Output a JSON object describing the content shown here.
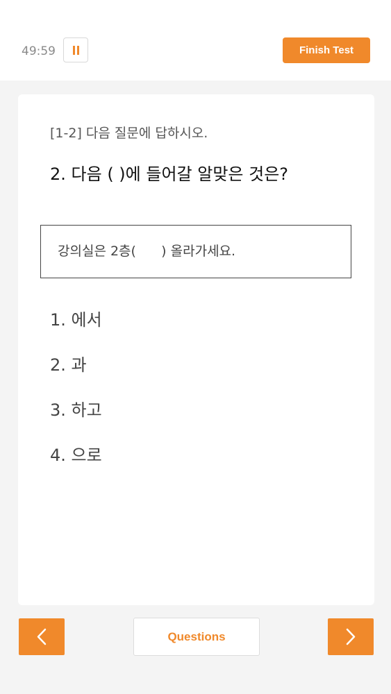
{
  "header": {
    "timer": "49:59",
    "pause_icon": "pause-icon",
    "finish_label": "Finish Test"
  },
  "question": {
    "instruction": "[1-2]  다음 질문에 답하시오.",
    "text": "2. 다음 (          )에 들어갈 알맞은 것은?",
    "passage": "강의실은 2층(      ) 올라가세요.",
    "options": [
      {
        "label": "1. 에서"
      },
      {
        "label": "2. 과"
      },
      {
        "label": "3. 하고"
      },
      {
        "label": "4. 으로"
      }
    ]
  },
  "footer": {
    "prev_icon": "chevron-left-icon",
    "questions_label": "Questions",
    "next_icon": "chevron-right-icon"
  },
  "colors": {
    "accent": "#f0892b",
    "background": "#f4f4f4",
    "card": "#ffffff"
  }
}
